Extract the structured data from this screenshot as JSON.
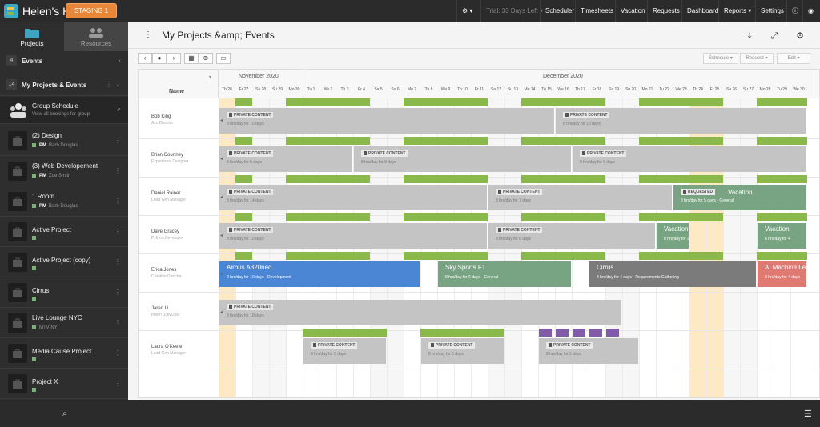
{
  "topbar": {
    "app_name": "Helen's HP",
    "staging": "STAGING 1",
    "trial": "Trial: 33 Days Left",
    "nav": [
      "Scheduler",
      "Timesheets",
      "Vacation",
      "Requests",
      "Dashboard",
      "Reports",
      "Settings"
    ]
  },
  "sidebar": {
    "tabs": [
      "Projects",
      "Resources"
    ],
    "events": {
      "count": "4",
      "label": "Events"
    },
    "my_projects": {
      "count": "14",
      "label": "My Projects & Events"
    },
    "group": {
      "title": "Group Schedule",
      "sub": "View all bookings for group"
    },
    "items": [
      {
        "title": "(2) Design",
        "pm": "PM",
        "manager": "Barb Douglas",
        "code": ""
      },
      {
        "title": "(3) Web Developement",
        "pm": "PM",
        "manager": "Zoe Smith",
        "code": ""
      },
      {
        "title": "1 Room",
        "pm": "PM",
        "manager": "Barb Douglas",
        "code": ""
      },
      {
        "title": "Active Project",
        "pm": "",
        "manager": "",
        "code": ""
      },
      {
        "title": "Active Project (copy)",
        "pm": "",
        "manager": "",
        "code": ""
      },
      {
        "title": "Cirrus",
        "pm": "",
        "manager": "",
        "code": ""
      },
      {
        "title": "Live Lounge NYC",
        "pm": "",
        "manager": "",
        "code": "MTV NY"
      },
      {
        "title": "Media Cause Project",
        "pm": "",
        "manager": "",
        "code": ""
      },
      {
        "title": "Project X",
        "pm": "",
        "manager": "",
        "code": ""
      }
    ]
  },
  "main": {
    "title": "My Projects &amp; Events",
    "name_header": "Name",
    "dropdowns": [
      "Schedule",
      "Request",
      "Edit"
    ],
    "months": [
      {
        "label": "November 2020",
        "start": 0
      },
      {
        "label": "December 2020",
        "start": 5
      }
    ],
    "days": [
      "Th 26",
      "Fr 27",
      "Sa 28",
      "Su 29",
      "Mo 30",
      "Tu 1",
      "We 2",
      "Th 3",
      "Fr 4",
      "Sa 5",
      "Su 6",
      "Mo 7",
      "Tu 8",
      "We 9",
      "Th 10",
      "Fr 11",
      "Sa 12",
      "Su 13",
      "Mo 14",
      "Tu 15",
      "We 16",
      "Th 17",
      "Fr 18",
      "Sa 19",
      "Su 20",
      "Mo 21",
      "Tu 22",
      "We 23",
      "Th 24",
      "Fr 25",
      "Sa 26",
      "Su 27",
      "Mo 28",
      "Tu 29",
      "We 30"
    ]
  },
  "rows": [
    {
      "name": "Bob King",
      "role": "Acc Director",
      "bars": [
        {
          "start": 0,
          "days": 20,
          "color": "gray",
          "tag": "PRIVATE CONTENT",
          "sub": "8 hrs/day for 15 days",
          "arrow": true
        },
        {
          "start": 20,
          "days": 15,
          "color": "gray",
          "tag": "PRIVATE CONTENT",
          "sub": "8 hrs/day for 15 days"
        }
      ]
    },
    {
      "name": "Brian Courtney",
      "role": "Experience Designer",
      "bars": [
        {
          "start": 0,
          "days": 8,
          "color": "gray",
          "tag": "PRIVATE CONTENT",
          "sub": "8 hrs/day for 5 days",
          "arrow": true
        },
        {
          "start": 8,
          "days": 13,
          "color": "gray",
          "tag": "PRIVATE CONTENT",
          "sub": "8 hrs/day for 9 days"
        },
        {
          "start": 21,
          "days": 14,
          "color": "gray",
          "tag": "PRIVATE CONTENT",
          "sub": "8 hrs/day for 9 days"
        }
      ]
    },
    {
      "name": "Daniel Rainer",
      "role": "Lead Gen Manager",
      "bars": [
        {
          "start": 0,
          "days": 16,
          "color": "gray",
          "tag": "PRIVATE CONTENT",
          "sub": "8 hrs/day for 14 days",
          "arrow": true
        },
        {
          "start": 16,
          "days": 11,
          "color": "gray",
          "tag": "PRIVATE CONTENT",
          "sub": "8 hrs/day for 7 days"
        },
        {
          "start": 27,
          "days": 8,
          "color": "sage",
          "tag": "REQUESTED",
          "title": "Vacation",
          "sub": "8 hrs/day for 5 days - General"
        }
      ]
    },
    {
      "name": "Dave Gracey",
      "role": "Python Developer",
      "bars": [
        {
          "start": 0,
          "days": 16,
          "color": "gray",
          "tag": "PRIVATE CONTENT",
          "sub": "8 hrs/day for 15 days",
          "arrow": true
        },
        {
          "start": 16,
          "days": 10,
          "color": "gray",
          "tag": "PRIVATE CONTENT",
          "sub": "8 hrs/day for 6 days"
        },
        {
          "start": 26,
          "days": 2,
          "color": "sage",
          "title": "Vacation",
          "sub": "8 hrs/day for 2"
        },
        {
          "start": 32,
          "days": 3,
          "color": "sage",
          "title": "Vacation",
          "sub": "8 hrs/day for 4"
        }
      ]
    },
    {
      "name": "Erica Jones",
      "role": "Creative Director",
      "bars": [
        {
          "start": 0,
          "days": 12,
          "color": "blue",
          "title": "Airbus A320neo",
          "sub": "8 hrs/day for 10 days - Development",
          "arrow": true
        },
        {
          "start": 13,
          "days": 8,
          "color": "sage",
          "title": "Sky Sports F1",
          "sub": "8 hrs/day for 6 days - General"
        },
        {
          "start": 22,
          "days": 10,
          "color": "dgray",
          "title": "Cirrus",
          "sub": "8 hrs/day for 4 days - Requirements Gathering"
        },
        {
          "start": 32,
          "days": 3,
          "color": "red",
          "title": "AI Machine Learn",
          "sub": "8 hrs/day for 4 days"
        }
      ]
    },
    {
      "name": "Jared Li",
      "role": "Intern (DevOps)",
      "bars": [
        {
          "start": 0,
          "days": 24,
          "color": "gray",
          "tag": "PRIVATE CONTENT",
          "sub": "8 hrs/day for 18 days",
          "arrow": true
        }
      ]
    },
    {
      "name": "Laura O'Keefe",
      "role": "Lead Gen Manager",
      "bars": [
        {
          "start": 5,
          "days": 5,
          "color": "gray",
          "tag": "PRIVATE CONTENT",
          "sub": "8 hrs/day for 5 days"
        },
        {
          "start": 12,
          "days": 5,
          "color": "gray",
          "tag": "PRIVATE CONTENT",
          "sub": "8 hrs/day for 5 days"
        },
        {
          "start": 19,
          "days": 6,
          "color": "gray",
          "tag": "PRIVATE CONTENT",
          "sub": "8 hrs/day for 5 days"
        }
      ]
    }
  ],
  "colors": {
    "green": "#8ab84a",
    "gray": "#c4c4c4",
    "dgray": "#7b7b7b",
    "sage": "#79a483",
    "blue": "#4a86d4",
    "red": "#de7a72",
    "purple": "#7f5ba8",
    "holiday": "#fde9c3",
    "weekend": "#f6f6f6"
  }
}
